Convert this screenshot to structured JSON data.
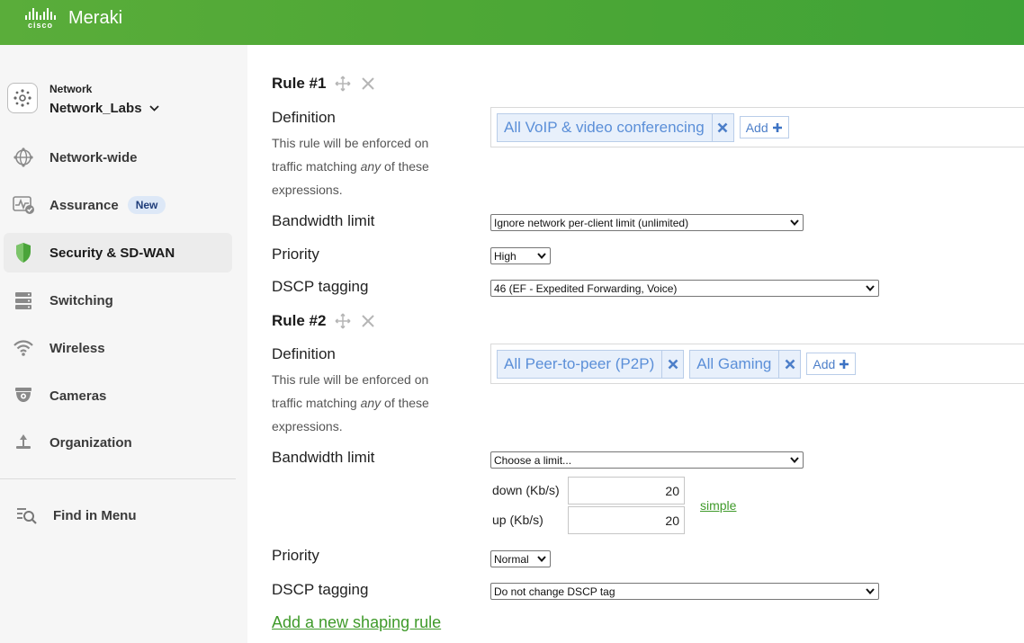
{
  "header": {
    "cisco": "cisco",
    "brand": "Meraki"
  },
  "sidebar": {
    "network_caption": "Network",
    "network_name": "Network_Labs",
    "items": [
      {
        "label": "Network-wide",
        "icon": "globe-icon"
      },
      {
        "label": "Assurance",
        "icon": "assurance-icon",
        "badge": "New"
      },
      {
        "label": "Security & SD-WAN",
        "icon": "shield-icon",
        "active": true
      },
      {
        "label": "Switching",
        "icon": "switch-icon"
      },
      {
        "label": "Wireless",
        "icon": "wifi-icon"
      },
      {
        "label": "Cameras",
        "icon": "camera-icon"
      },
      {
        "label": "Organization",
        "icon": "organization-icon"
      }
    ],
    "find_menu": "Find in Menu"
  },
  "rules": [
    {
      "title": "Rule #1",
      "definition_label": "Definition",
      "help_line1": "This rule will be enforced on",
      "help_line2_pre": "traffic matching ",
      "help_line2_em": "any",
      "help_line2_post": " of these",
      "help_line3": "expressions.",
      "tags": [
        "All VoIP & video conferencing"
      ],
      "add_label": "Add",
      "bandwidth_label": "Bandwidth limit",
      "bandwidth_value": "Ignore network per-client limit (unlimited)",
      "priority_label": "Priority",
      "priority_value": "High",
      "dscp_label": "DSCP tagging",
      "dscp_value": "46 (EF - Expedited Forwarding, Voice)"
    },
    {
      "title": "Rule #2",
      "definition_label": "Definition",
      "help_line1": "This rule will be enforced on",
      "help_line2_pre": "traffic matching ",
      "help_line2_em": "any",
      "help_line2_post": " of these",
      "help_line3": "expressions.",
      "tags": [
        "All Peer-to-peer (P2P)",
        "All Gaming"
      ],
      "add_label": "Add",
      "bandwidth_label": "Bandwidth limit",
      "bandwidth_value": "Choose a limit...",
      "down_label": "down (Kb/s)",
      "down_value": "20",
      "up_label": "up (Kb/s)",
      "up_value": "20",
      "simple_link": "simple",
      "priority_label": "Priority",
      "priority_value": "Normal",
      "dscp_label": "DSCP tagging",
      "dscp_value": "Do not change DSCP tag"
    }
  ],
  "add_rule_link": "Add a new shaping rule",
  "colors": {
    "brand_green": "#4fa836",
    "tag_blue": "#5b8fd8",
    "link_green": "#3f9a2a"
  }
}
